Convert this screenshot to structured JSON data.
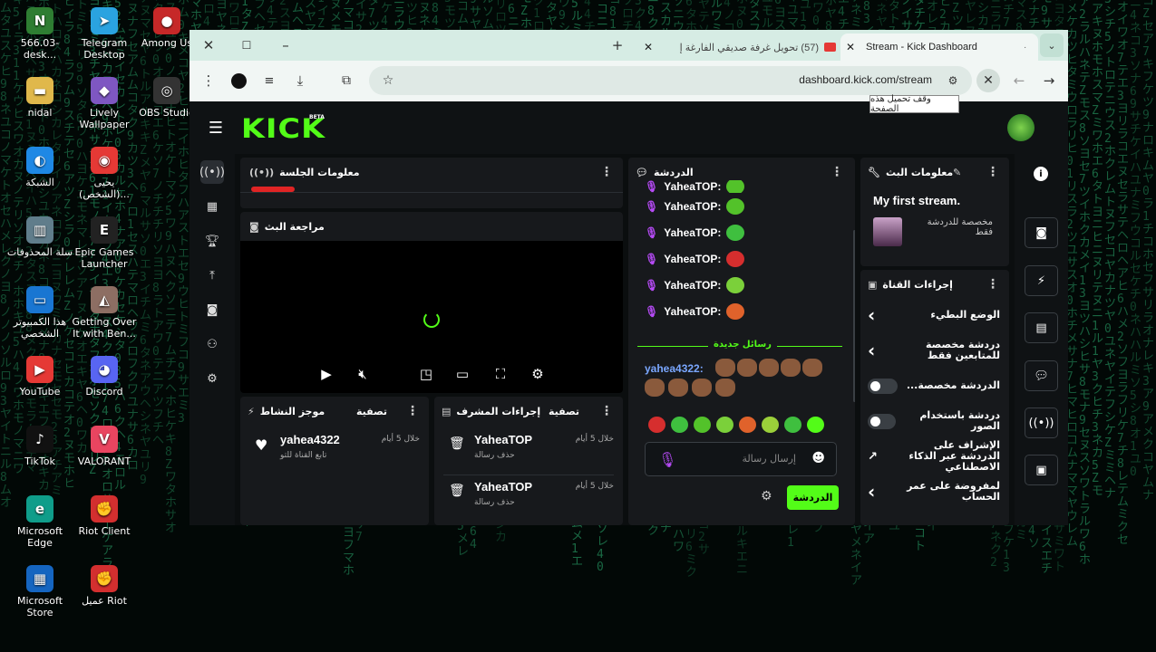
{
  "desktop": {
    "icons": [
      {
        "label": "566.03-desk...",
        "color": "#2e7d32",
        "glyph": "N"
      },
      {
        "label": "Telegram Desktop",
        "color": "#2aa3e0",
        "glyph": "➤"
      },
      {
        "label": "Among Us",
        "color": "#c62828",
        "glyph": "●"
      },
      {
        "label": "nidal",
        "color": "#e0b84b",
        "glyph": "▬"
      },
      {
        "label": "Lively Wallpaper",
        "color": "#7e57c2",
        "glyph": "◆"
      },
      {
        "label": "OBS Studio",
        "color": "#333333",
        "glyph": "◎"
      },
      {
        "label": "الشبكة",
        "color": "#1e88e5",
        "glyph": "◐"
      },
      {
        "label": "يحيى (الشخص)...",
        "color": "#e53935",
        "glyph": "◉"
      },
      {
        "label": "سلة المحذوفات",
        "color": "#607d8b",
        "glyph": "▥"
      },
      {
        "label": "Epic Games Launcher",
        "color": "#222222",
        "glyph": "E"
      },
      {
        "label": "هذا الكمبيوتر الشخصي",
        "color": "#1976d2",
        "glyph": "▭"
      },
      {
        "label": "Getting Over It with Ben...",
        "color": "#8d6e63",
        "glyph": "◭"
      },
      {
        "label": "YouTube",
        "color": "#e53935",
        "glyph": "▶"
      },
      {
        "label": "Discord",
        "color": "#5865f2",
        "glyph": "◕"
      },
      {
        "label": "TikTok",
        "color": "#111111",
        "glyph": "♪"
      },
      {
        "label": "VALORANT",
        "color": "#e94560",
        "glyph": "V"
      },
      {
        "label": "Microsoft Edge",
        "color": "#0f9d8a",
        "glyph": "e"
      },
      {
        "label": "Riot Client",
        "color": "#d32f2f",
        "glyph": "✊"
      },
      {
        "label": "Microsoft Store",
        "color": "#1565c0",
        "glyph": "▦"
      },
      {
        "label": "عميل Riot",
        "color": "#d32f2f",
        "glyph": "✊"
      }
    ]
  },
  "browser": {
    "tabs": [
      {
        "label": "Stream - Kick Dashboard",
        "active": true
      },
      {
        "label": "(57) تحويل غرفة صديقي الفارغة إ",
        "active": false
      }
    ],
    "url": "dashboard.kick.com/stream",
    "tooltip": "وقف تحميل هذه الصفحة"
  },
  "kick": {
    "logo": "KICK",
    "beta": "BETA",
    "session_panel": {
      "title": "معلومات الجلسة"
    },
    "preview_panel": {
      "title": "مراجعة البث"
    },
    "activity_panel": {
      "title": "موجز النشاط",
      "filter": "تصفية",
      "items": [
        {
          "name": "yahea4322",
          "sub": "تابع القناة للتو",
          "time": "خلال 5 أيام"
        }
      ]
    },
    "mod_panel": {
      "title": "إجراءات المشرف",
      "filter": "تصفية",
      "items": [
        {
          "name": "YaheaTOP",
          "sub": "حذف رسالة",
          "time": "خلال 5 أيام"
        },
        {
          "name": "YaheaTOP",
          "sub": "حذف رسالة",
          "time": "خلال 5 أيام"
        }
      ]
    },
    "chat_panel": {
      "title": "الدردشة",
      "username": "YaheaTOP",
      "partial_line": "YaheaTOP:",
      "messages": [
        {
          "user": "YaheaTOP:",
          "emote_color": "#53c22a"
        },
        {
          "user": "YaheaTOP:",
          "emote_color": "#3fbf3f"
        },
        {
          "user": "YaheaTOP:",
          "emote_color": "#d62e2e"
        },
        {
          "user": "YaheaTOP:",
          "emote_color": "#7bd03a"
        },
        {
          "user": "YaheaTOP:",
          "emote_color": "#e0622b"
        }
      ],
      "new_messages": "رسائل جديدة",
      "last_user": "yahea4322:",
      "input_placeholder": "إرسال رسالة",
      "send_label": "الدردشة"
    },
    "stream_info": {
      "title": "معلومات البث",
      "stream_title": "My first stream.",
      "category": "مخصصة للدردشة فقط"
    },
    "channel_actions": {
      "title": "إجراءات القناة",
      "items": [
        {
          "label": "الوضع البطيء",
          "control": "arrow"
        },
        {
          "label": "دردشة مخصصة للمتابعين فقط",
          "control": "arrow"
        },
        {
          "label": "الدردشة مخصصة...",
          "control": "toggle"
        },
        {
          "label": "دردشة باستخدام الصور",
          "control": "toggle"
        },
        {
          "label": "الإشراف على الدردشة عبر الذكاء الاصطناعي",
          "control": "external"
        },
        {
          "label": "لمفروضة على عمر الحساب",
          "control": "arrow"
        }
      ]
    }
  }
}
